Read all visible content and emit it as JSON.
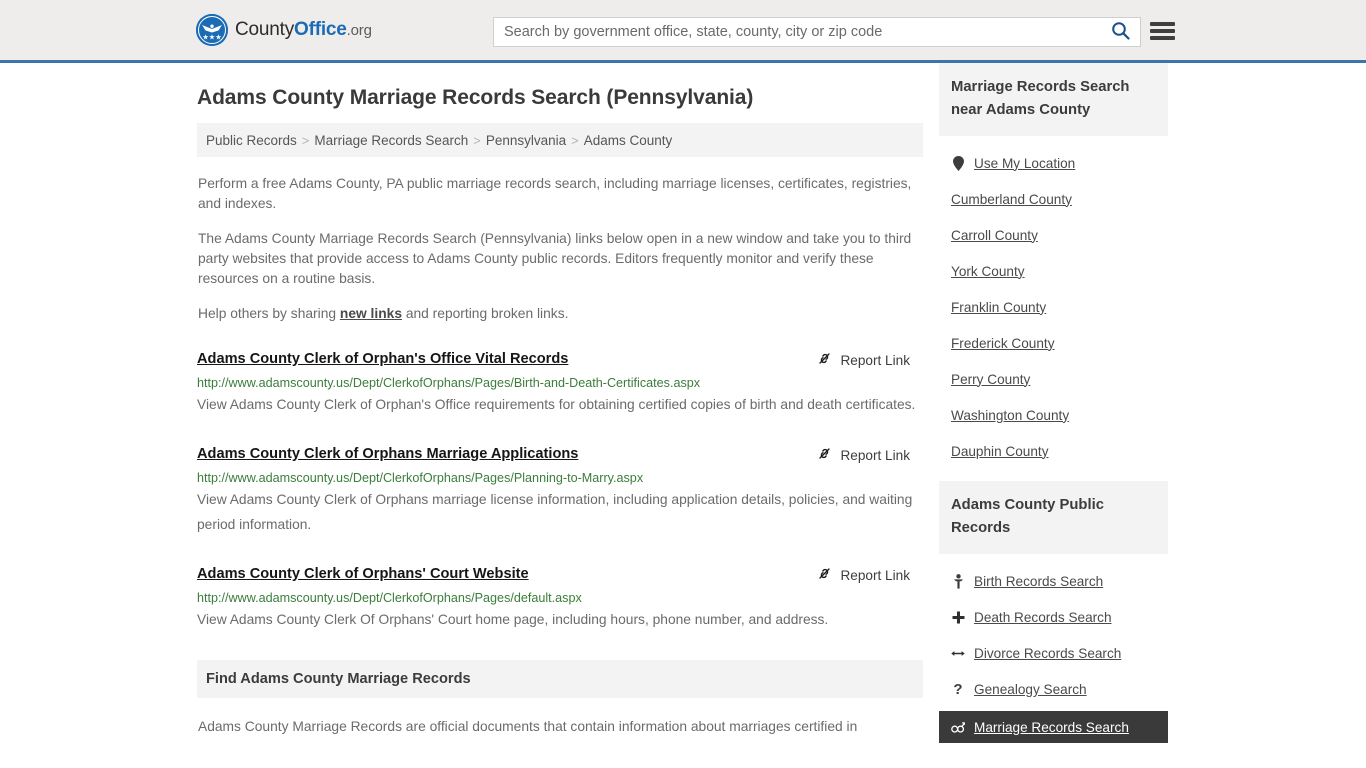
{
  "header": {
    "brand": {
      "part1": "County",
      "part2": "Office",
      "part3": ".org",
      "seal_icon": "eagle-seal-icon"
    },
    "search": {
      "placeholder": "Search by government office, state, county, city or zip code",
      "value": "",
      "search_icon": "search-icon"
    },
    "menu_icon": "hamburger-menu-icon",
    "accent_color": "#3b75ab"
  },
  "page": {
    "title": "Adams County Marriage Records Search (Pennsylvania)"
  },
  "breadcrumb": {
    "separator": ">",
    "items": [
      {
        "label": "Public Records"
      },
      {
        "label": "Marriage Records Search"
      },
      {
        "label": "Pennsylvania"
      },
      {
        "label": "Adams County"
      }
    ]
  },
  "intro": {
    "p1": "Perform a free Adams County, PA public marriage records search, including marriage licenses, certificates, registries, and indexes.",
    "p2": "The Adams County Marriage Records Search (Pennsylvania) links below open in a new window and take you to third party websites that provide access to Adams County public records. Editors frequently monitor and verify these resources on a routine basis.",
    "p3_before": "Help others by sharing ",
    "p3_link": "new links",
    "p3_after": " and reporting broken links."
  },
  "results": {
    "report_label": "Report Link",
    "report_icon": "broken-link-icon",
    "items": [
      {
        "title": "Adams County Clerk of Orphan's Office Vital Records",
        "url": "http://www.adamscounty.us/Dept/ClerkofOrphans/Pages/Birth-and-Death-Certificates.aspx",
        "description": "View Adams County Clerk of Orphan's Office requirements for obtaining certified copies of birth and death certificates."
      },
      {
        "title": "Adams County Clerk of Orphans Marriage Applications",
        "url": "http://www.adamscounty.us/Dept/ClerkofOrphans/Pages/Planning-to-Marry.aspx",
        "description": "View Adams County Clerk of Orphans marriage license information, including application details, policies, and waiting period information."
      },
      {
        "title": "Adams County Clerk of Orphans' Court Website",
        "url": "http://www.adamscounty.us/Dept/ClerkofOrphans/Pages/default.aspx",
        "description": "View Adams County Clerk Of Orphans' Court home page, including hours, phone number, and address."
      }
    ]
  },
  "find_section": {
    "heading": "Find Adams County Marriage Records",
    "body": "Adams County Marriage Records are official documents that contain information about marriages certified in"
  },
  "sidebar": {
    "nearby": {
      "heading": "Marriage Records Search near Adams County",
      "items": [
        {
          "label": "Use My Location",
          "icon": "map-pin-icon"
        },
        {
          "label": "Cumberland County",
          "icon": ""
        },
        {
          "label": "Carroll County",
          "icon": ""
        },
        {
          "label": "York County",
          "icon": ""
        },
        {
          "label": "Franklin County",
          "icon": ""
        },
        {
          "label": "Frederick County",
          "icon": ""
        },
        {
          "label": "Perry County",
          "icon": ""
        },
        {
          "label": "Washington County",
          "icon": ""
        },
        {
          "label": "Dauphin County",
          "icon": ""
        }
      ]
    },
    "public_records": {
      "heading": "Adams County Public Records",
      "items": [
        {
          "label": "Birth Records Search",
          "icon": "baby-icon",
          "glyph": "Ŧ",
          "active": false
        },
        {
          "label": "Death Records Search",
          "icon": "cross-icon",
          "glyph": "✚",
          "active": false
        },
        {
          "label": "Divorce Records Search",
          "icon": "left-right-arrow-icon",
          "glyph": "↔",
          "active": false
        },
        {
          "label": "Genealogy Search",
          "icon": "question-mark-icon",
          "glyph": "?",
          "active": false
        },
        {
          "label": "Marriage Records Search",
          "icon": "male-female-icon",
          "glyph": "⚥",
          "active": true
        }
      ],
      "highlight_color": "#3a3a3a"
    }
  }
}
